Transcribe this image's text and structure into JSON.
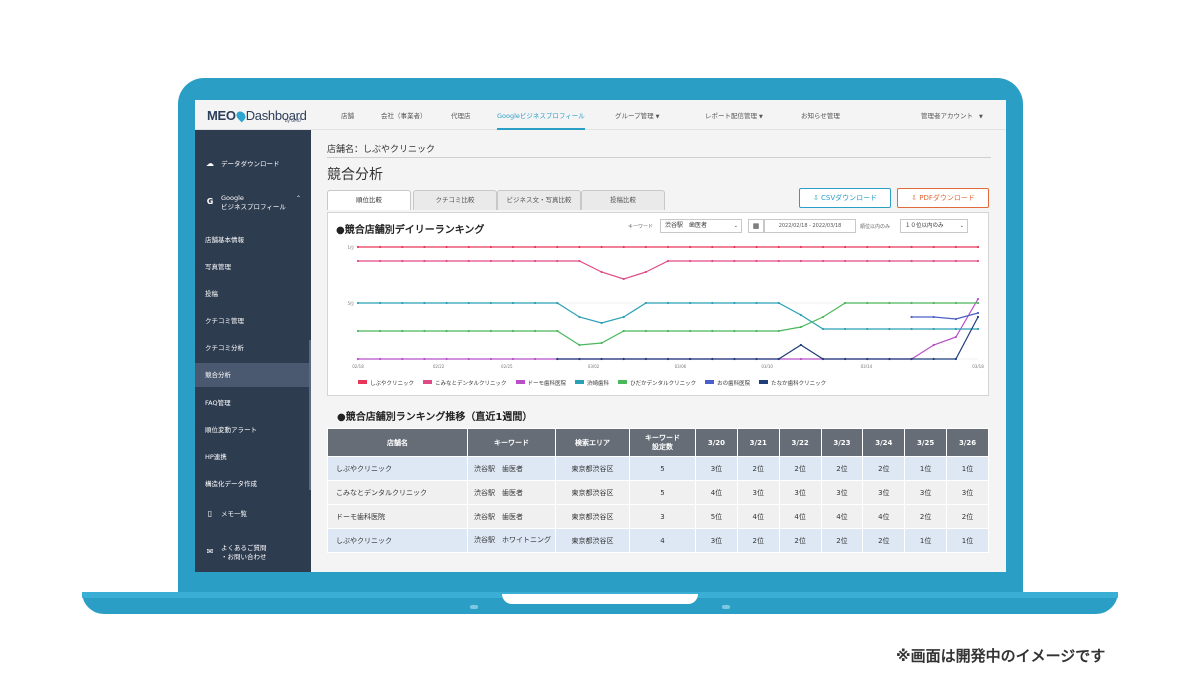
{
  "nav": {
    "logo": "MEO",
    "logo_rest": "Dashboard",
    "logo_sub": "by GMO",
    "items": [
      {
        "label": "店舗"
      },
      {
        "label": "会社（事業者）"
      },
      {
        "label": "代理店"
      },
      {
        "label": "Googleビジネスプロフィール"
      },
      {
        "label": "グループ管理"
      },
      {
        "label": "レポート配信管理"
      },
      {
        "label": "お知らせ管理"
      }
    ],
    "account": "管理者アカウント"
  },
  "sidebar": {
    "items": [
      {
        "label": "データダウンロード",
        "icon": "cloud-download-icon"
      },
      {
        "label": "Google",
        "label2": "ビジネスプロフィール",
        "icon": "google-icon"
      },
      {
        "label": "店舗基本情報"
      },
      {
        "label": "写真管理"
      },
      {
        "label": "投稿"
      },
      {
        "label": "クチコミ管理"
      },
      {
        "label": "クチコミ分析"
      },
      {
        "label": "競合分析"
      },
      {
        "label": "FAQ管理"
      },
      {
        "label": "順位変動アラート"
      },
      {
        "label": "HP連携"
      },
      {
        "label": "構造化データ作成"
      },
      {
        "label": "メモ一覧",
        "icon": "document-icon"
      },
      {
        "label": "よくあるご質問",
        "label2": "・お問い合わせ",
        "icon": "mail-icon"
      }
    ]
  },
  "main": {
    "store_label": "店舗名：しぶやクリニック",
    "title": "競合分析",
    "tabs": [
      "順位比較",
      "クチコミ比較",
      "ビジネス文・写真比較",
      "投稿比較"
    ],
    "csv_button": "CSVダウンロード",
    "pdf_button": "PDFダウンロード"
  },
  "chart_card": {
    "title": "●競合店舗別デイリーランキング",
    "keyword_label": "キーワード",
    "keyword_value": "渋谷駅　歯医者",
    "date_range": "2022/02/18 - 2022/03/18",
    "rank_label": "順位以内のみ",
    "rank_value": "１０位以内のみ"
  },
  "chart_data": {
    "type": "line",
    "title": "●競合店舗別デイリーランキング",
    "x_ticks": [
      "02/18",
      "02/22",
      "02/25",
      "03/02",
      "03/06",
      "03/10",
      "03/14",
      "03/18"
    ],
    "y_ticks": [
      "1位",
      "5位"
    ],
    "y_reversed": true,
    "series": [
      {
        "name": "しぶやクリニック",
        "color": "#e8365a"
      },
      {
        "name": "こみなとデンタルクリニック",
        "color": "#e04a87"
      },
      {
        "name": "ドーモ歯科医院",
        "color": "#b84fc6"
      },
      {
        "name": "渋崎歯科",
        "color": "#2aa0b6"
      },
      {
        "name": "ひだかデンタルクリニック",
        "color": "#4cb85c"
      },
      {
        "name": "おの歯科医院",
        "color": "#4a5fc8"
      },
      {
        "name": "たなか歯科クリニック",
        "color": "#1f3e7a"
      }
    ]
  },
  "table": {
    "title": "●競合店舗別ランキング推移（直近1週間）",
    "headers": [
      "店舗名",
      "キーワード",
      "検索エリア",
      "キーワード設定数",
      "3/20",
      "3/21",
      "3/22",
      "3/23",
      "3/24",
      "3/25",
      "3/26"
    ],
    "header_kw_count_1": "キーワード",
    "header_kw_count_2": "設定数",
    "rows": [
      {
        "name": "しぶやクリニック",
        "kw": "渋谷駅　歯医者",
        "area": "東京都渋谷区",
        "count": "5",
        "r": [
          "3位",
          "2位",
          "2位",
          "2位",
          "2位",
          "1位",
          "1位"
        ]
      },
      {
        "name": "こみなとデンタルクリニック",
        "kw": "渋谷駅　歯医者",
        "area": "東京都渋谷区",
        "count": "5",
        "r": [
          "4位",
          "3位",
          "3位",
          "3位",
          "3位",
          "3位",
          "3位"
        ]
      },
      {
        "name": "ドーモ歯科医院",
        "kw": "渋谷駅　歯医者",
        "area": "東京都渋谷区",
        "count": "3",
        "r": [
          "5位",
          "4位",
          "4位",
          "4位",
          "4位",
          "2位",
          "2位"
        ]
      },
      {
        "name": "しぶやクリニック",
        "kw": "渋谷駅　ホワイトニング",
        "area": "東京都渋谷区",
        "count": "4",
        "r": [
          "3位",
          "2位",
          "2位",
          "2位",
          "2位",
          "1位",
          "1位"
        ]
      }
    ]
  },
  "caption": "※画面は開発中のイメージです"
}
